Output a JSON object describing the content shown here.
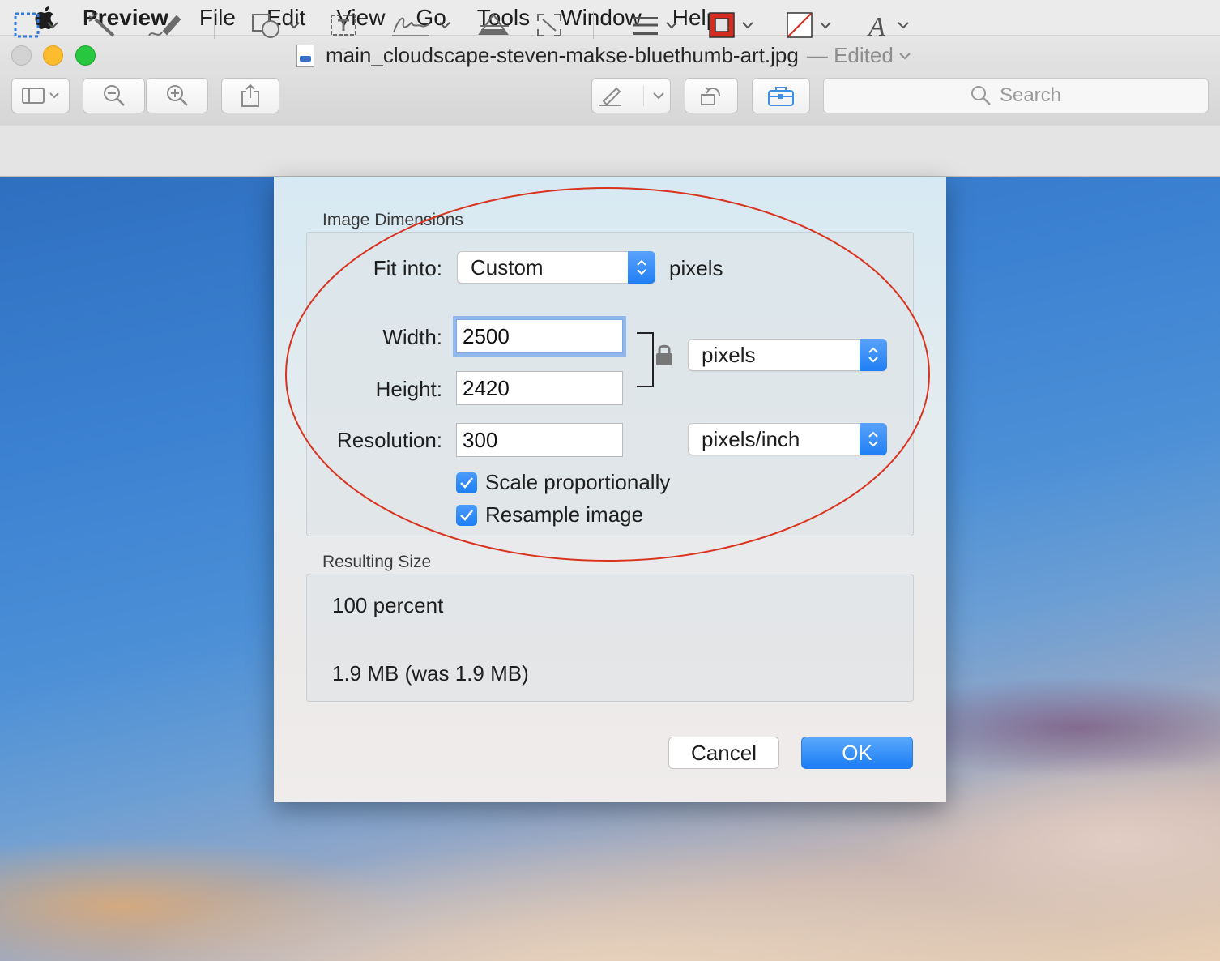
{
  "menubar": {
    "apple_icon": "apple-logo-icon",
    "app_name": "Preview",
    "items": [
      "File",
      "Edit",
      "View",
      "Go",
      "Tools",
      "Window",
      "Help"
    ]
  },
  "window": {
    "title": "main_cloudscape-steven-makse-bluethumb-art.jpg",
    "title_suffix": "— Edited",
    "search_placeholder": "Search"
  },
  "dialog": {
    "image_dimensions_label": "Image Dimensions",
    "fit_into_label": "Fit into:",
    "fit_into_value": "Custom",
    "fit_into_unit": "pixels",
    "width_label": "Width:",
    "width_value": "2500",
    "height_label": "Height:",
    "height_value": "2420",
    "resolution_label": "Resolution:",
    "resolution_value": "300",
    "size_unit": "pixels",
    "resolution_unit": "pixels/inch",
    "scale_label": "Scale proportionally",
    "scale_checked": true,
    "resample_label": "Resample image",
    "resample_checked": true,
    "resulting_size_label": "Resulting Size",
    "percent": "100 percent",
    "file_size": "1.9 MB (was 1.9 MB)",
    "cancel_label": "Cancel",
    "ok_label": "OK"
  },
  "colors": {
    "accent": "#1f7ff4",
    "annotation_red": "#d9321f",
    "stroke_color_swatch": "#d62b1f"
  }
}
